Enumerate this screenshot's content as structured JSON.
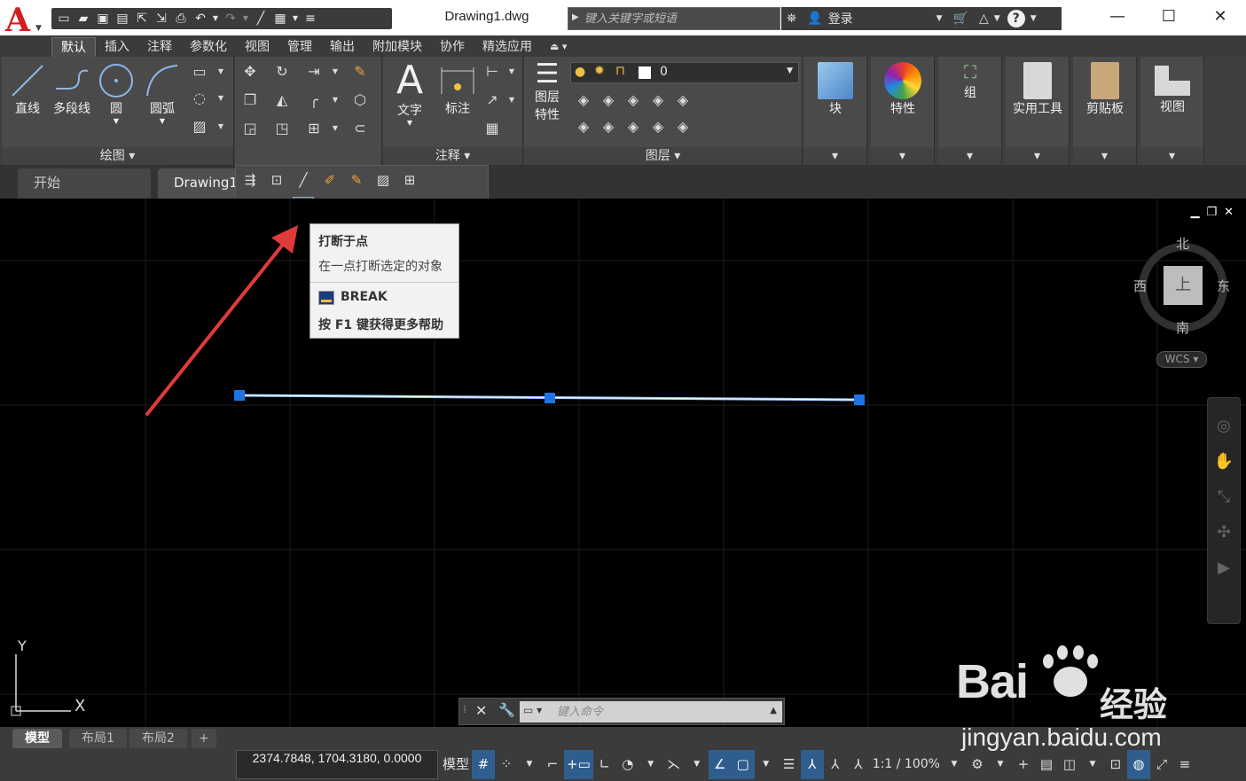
{
  "titlebar": {
    "logo_letter": "A",
    "document_title": "Drawing1.dwg",
    "search_placeholder": "键入关键字或短语",
    "login_label": "登录",
    "help_label": "?"
  },
  "ribbon_tabs": [
    "默认",
    "插入",
    "注释",
    "参数化",
    "视图",
    "管理",
    "输出",
    "附加模块",
    "协作",
    "精选应用"
  ],
  "panels": {
    "draw": {
      "title": "绘图",
      "tools": [
        "直线",
        "多段线",
        "圆",
        "圆弧"
      ]
    },
    "annotation": {
      "title": "注释",
      "tools": [
        "文字",
        "标注"
      ]
    },
    "layers": {
      "title": "图层",
      "tool": "图层\n特性",
      "tool_line1": "图层",
      "tool_line2": "特性",
      "current_layer": "0"
    },
    "block": {
      "label": "块"
    },
    "properties": {
      "label": "特性"
    },
    "group": {
      "label": "组"
    },
    "utilities": {
      "label": "实用工具"
    },
    "clipboard": {
      "label": "剪贴板"
    },
    "view": {
      "label": "视图"
    }
  },
  "file_tabs": [
    "开始",
    "Drawing1"
  ],
  "tooltip": {
    "title": "打断于点",
    "description": "在一点打断选定的对象",
    "command": "BREAK",
    "help": "按 F1 键获得更多帮助"
  },
  "viewcube": {
    "north": "北",
    "south": "南",
    "west": "西",
    "east": "东",
    "face": "上",
    "wcs": "WCS"
  },
  "ucs": {
    "x": "X",
    "y": "Y"
  },
  "cmdline": {
    "placeholder": "键入命令"
  },
  "layout_tabs": [
    "模型",
    "布局1",
    "布局2",
    "+"
  ],
  "statusbar": {
    "coordinates": "2374.7848, 1704.3180, 0.0000",
    "model_label": "模型",
    "scale": "1:1 / 100%"
  },
  "watermark": {
    "brand": "Bai",
    "brand_cn": "经验",
    "url": "jingyan.baidu.com"
  },
  "colors": {
    "accent": "#2f5e8e",
    "grip": "#1e74e6",
    "arrow": "#e03a3a"
  }
}
